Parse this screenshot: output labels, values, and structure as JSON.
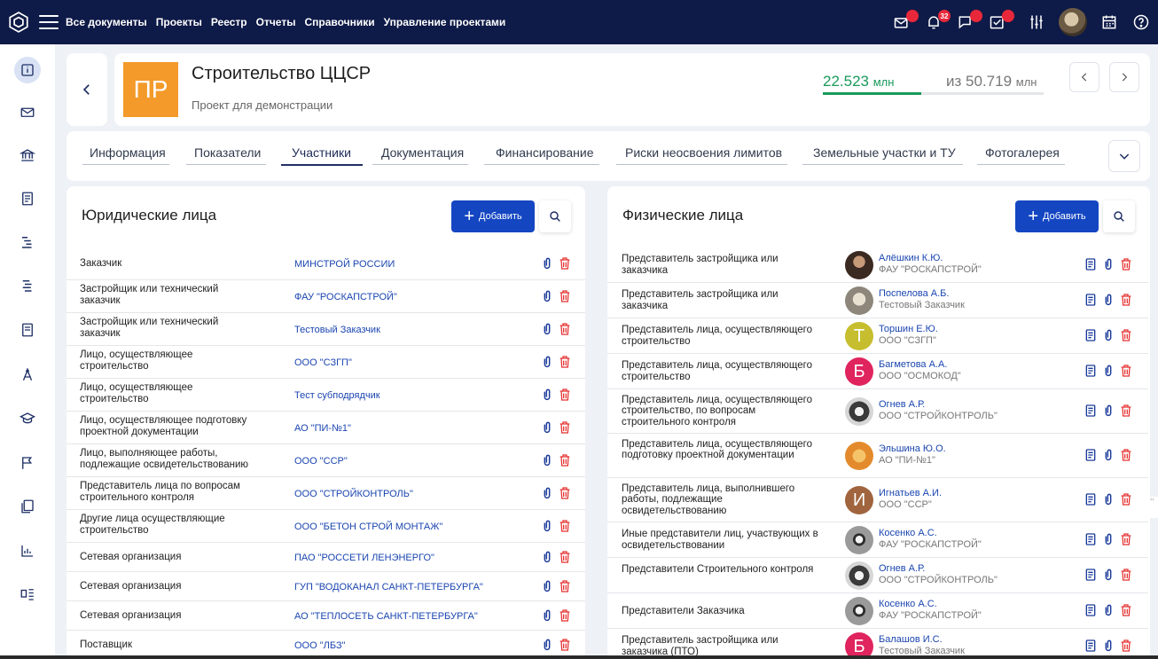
{
  "topnav": {
    "items": [
      "Все документы",
      "Проекты",
      "Реестр",
      "Отчеты",
      "Справочники",
      "Управление проектами"
    ],
    "notifications_count": "32",
    "colors": {
      "bar": "#0e1a47",
      "badge": "#e8283a"
    },
    "icons": [
      "logo-icon",
      "menu-icon",
      "mail-icon",
      "bell-icon",
      "chat-icon",
      "tasks-icon",
      "settings-sliders-icon",
      "calendar-icon",
      "help-icon"
    ]
  },
  "sidebar": {
    "icons": [
      "info-icon",
      "mail-icon",
      "bank-icon",
      "document-icon",
      "gantt-icon",
      "list-icon",
      "file-icon",
      "compass-icon",
      "education-icon",
      "flag-icon",
      "copy-icon",
      "chart-icon",
      "structure-icon"
    ]
  },
  "project": {
    "initials": "ПР",
    "title": "Строительство ЦЦСР",
    "subtitle": "Проект для демонстрации",
    "amount_current": "22.523",
    "amount_total": "50.719",
    "unit": "млн",
    "of_label": "из",
    "progress": 0.444,
    "avatar_color": "#f39a2b"
  },
  "tabs": [
    "Информация",
    "Показатели",
    "Участники",
    "Документация",
    "Финансирование",
    "Риски неосвоения лимитов",
    "Земельные участки и ТУ",
    "Фотогалерея"
  ],
  "active_tab": "Участники",
  "legal": {
    "title": "Юридические лица",
    "add_label": "Добавить",
    "rows": [
      {
        "role": "Заказчик",
        "org": "МИНСТРОЙ РОССИИ"
      },
      {
        "role": "Застройщик или технический заказчик",
        "org": "ФАУ \"РОСКАПСТРОЙ\""
      },
      {
        "role": "Застройщик или технический заказчик",
        "org": "Тестовый Заказчик"
      },
      {
        "role": "Лицо, осуществляющее строительство",
        "org": "ООО \"СЗГП\""
      },
      {
        "role": "Лицо, осуществляющее строительство",
        "org": "Тест субподрядчик"
      },
      {
        "role": "Лицо, осуществляющее подготовку проектной документации",
        "org": "АО \"ПИ-№1\""
      },
      {
        "role": "Лицо, выполняющее работы, подлежащие освидетельствованию",
        "org": "ООО \"ССР\""
      },
      {
        "role": "Представитель лица по вопросам строительного контроля",
        "org": "ООО \"СТРОЙКОНТРОЛЬ\""
      },
      {
        "role": "Другие лица осуществляющие строительство",
        "org": "ООО \"БЕТОН СТРОЙ МОНТАЖ\""
      },
      {
        "role": "Сетевая организация",
        "org": "ПАО \"РОССЕТИ ЛЕНЭНЕРГО\""
      },
      {
        "role": "Сетевая организация",
        "org": "ГУП \"ВОДОКАНАЛ САНКТ-ПЕТЕРБУРГА\""
      },
      {
        "role": "Сетевая организация",
        "org": "АО \"ТЕПЛОСЕТЬ САНКТ-ПЕТЕРБУРГА\""
      },
      {
        "role": "Поставщик",
        "org": "ООО \"ЛБЗ\""
      }
    ]
  },
  "physical": {
    "title": "Физические лица",
    "add_label": "Добавить",
    "rows": [
      {
        "role": "Представитель застройщика или заказчика",
        "name": "Алёшкин К.Ю.",
        "org": "ФАУ \"РОСКАПСТРОЙ\"",
        "avatar": "photo-man",
        "letter": ""
      },
      {
        "role": "Представитель застройщика или заказчика",
        "name": "Поспелова А.Б.",
        "org": "Тестовый Заказчик",
        "avatar": "photo-cat",
        "letter": ""
      },
      {
        "role": "Представитель лица, осуществляющего строительство",
        "name": "Торшин Е.Ю.",
        "org": "ООО \"СЗГП\"",
        "avatar": "letter",
        "letter": "Т",
        "color": "#c6be2e"
      },
      {
        "role": "Представитель лица, осуществляющего строительство",
        "name": "Багметова А.А.",
        "org": "ООО \"ОСМОКОД\"",
        "avatar": "letter",
        "letter": "Б",
        "color": "#e0245e"
      },
      {
        "role": "Представитель лица, осуществляющего строительство, по вопросам строительного контроля",
        "name": "Огнев А.Р.",
        "org": "ООО \"СТРОЙКОНТРОЛЬ\"",
        "avatar": "photo-robot",
        "letter": ""
      },
      {
        "role": "Представитель лица, осуществляющего подготовку проектной документации",
        "name": "Эльшина Ю.О.",
        "org": "АО \"ПИ-№1\"",
        "avatar": "photo-fox",
        "letter": ""
      },
      {
        "role": "Представитель лица, выполнившего работы, подлежащие освидетельствованию",
        "name": "Игнатьев А.И.",
        "org": "ООО \"ССР\"",
        "avatar": "letter",
        "letter": "И",
        "color": "#a0653e"
      },
      {
        "role": "Иные представители лиц, участвующих в освидетельствовании",
        "name": "Косенко А.С.",
        "org": "ФАУ \"РОСКАПСТРОЙ\"",
        "avatar": "photo-raccoon",
        "letter": ""
      },
      {
        "role": "Представители Строительного контроля",
        "name": "Огнев А.Р.",
        "org": "ООО \"СТРОЙКОНТРОЛЬ\"",
        "avatar": "photo-robot",
        "letter": ""
      },
      {
        "role": "Представители Заказчика",
        "name": "Косенко А.С.",
        "org": "ФАУ \"РОСКАПСТРОЙ\"",
        "avatar": "photo-raccoon",
        "letter": ""
      },
      {
        "role": "Представитель застройщика или заказчика (ПТО)",
        "name": "Балашов И.С.",
        "org": "Тестовый Заказчик",
        "avatar": "letter",
        "letter": "Б",
        "color": "#e0245e"
      }
    ]
  },
  "row_icons": [
    "document-icon",
    "attach-icon",
    "delete-icon"
  ],
  "colors": {
    "accent": "#1446c2",
    "link": "#1a45b0",
    "delete": "#e5302f",
    "money": "#1a9a5a"
  }
}
